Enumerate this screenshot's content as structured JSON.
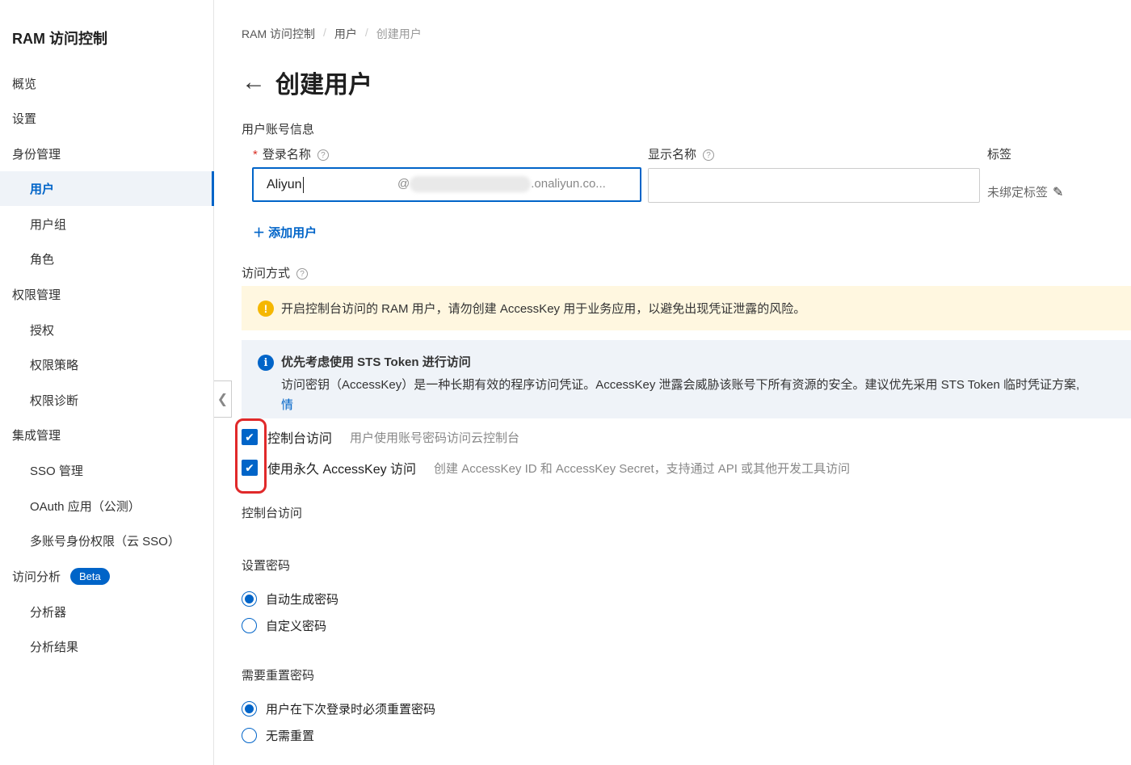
{
  "sidebar": {
    "title": "RAM 访问控制",
    "items": [
      {
        "label": "概览"
      },
      {
        "label": "设置"
      },
      {
        "label": "身份管理"
      },
      {
        "label": "用户"
      },
      {
        "label": "用户组"
      },
      {
        "label": "角色"
      },
      {
        "label": "权限管理"
      },
      {
        "label": "授权"
      },
      {
        "label": "权限策略"
      },
      {
        "label": "权限诊断"
      },
      {
        "label": "集成管理"
      },
      {
        "label": "SSO 管理"
      },
      {
        "label": "OAuth 应用（公测）"
      },
      {
        "label": "多账号身份权限（云 SSO）"
      },
      {
        "label": "访问分析",
        "badge": "Beta"
      },
      {
        "label": "分析器"
      },
      {
        "label": "分析结果"
      }
    ]
  },
  "breadcrumb": [
    "RAM 访问控制",
    "用户",
    "创建用户"
  ],
  "breadcrumb_sep": "/",
  "page": {
    "title": "创建用户",
    "back_glyph": "←"
  },
  "account_section": {
    "heading": "用户账号信息",
    "login_name_label": "登录名称",
    "login_name_value": "Aliyun",
    "domain_prefix": "@",
    "domain_suffix": ".onaliyun.co...",
    "display_name_label": "显示名称",
    "display_name_value": "",
    "tags_label": "标签",
    "tags_value": "未绑定标签",
    "add_user": "＋ 添加用户"
  },
  "access_section": {
    "heading": "访问方式",
    "warning": "开启控制台访问的 RAM 用户，请勿创建 AccessKey 用于业务应用，以避免出现凭证泄露的风险。",
    "info_title": "优先考虑使用 STS Token 进行访问",
    "info_desc": "访问密钥（AccessKey）是一种长期有效的程序访问凭证。AccessKey 泄露会威胁该账号下所有资源的安全。建议优先采用 STS Token 临时凭证方案,",
    "info_link": "情",
    "options": [
      {
        "label": "控制台访问",
        "desc": "用户使用账号密码访问云控制台",
        "checked": true
      },
      {
        "label": "使用永久 AccessKey 访问",
        "desc": "创建 AccessKey ID 和 AccessKey Secret，支持通过 API 或其他开发工具访问",
        "checked": true
      }
    ]
  },
  "console_section": {
    "heading": "控制台访问",
    "password_heading": "设置密码",
    "password_options": [
      {
        "label": "自动生成密码",
        "selected": true
      },
      {
        "label": "自定义密码",
        "selected": false
      }
    ],
    "reset_heading": "需要重置密码",
    "reset_options": [
      {
        "label": "用户在下次登录时必须重置密码",
        "selected": true
      },
      {
        "label": "无需重置",
        "selected": false
      }
    ]
  }
}
